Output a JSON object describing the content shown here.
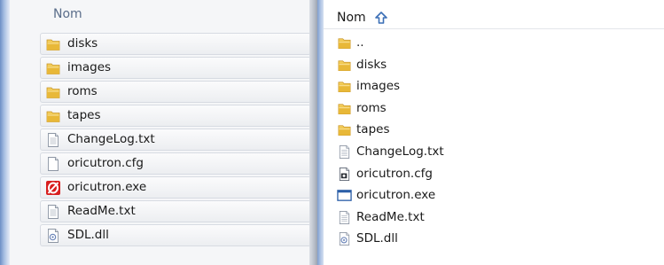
{
  "left_pane": {
    "column_header": "Nom",
    "files": [
      {
        "name": "disks",
        "icon": "folder-icon"
      },
      {
        "name": "images",
        "icon": "folder-icon"
      },
      {
        "name": "roms",
        "icon": "folder-icon"
      },
      {
        "name": "tapes",
        "icon": "folder-icon"
      },
      {
        "name": "ChangeLog.txt",
        "icon": "text-file-icon"
      },
      {
        "name": "oricutron.cfg",
        "icon": "blank-file-icon"
      },
      {
        "name": "oricutron.exe",
        "icon": "oricutron-app-icon"
      },
      {
        "name": "ReadMe.txt",
        "icon": "text-file-icon"
      },
      {
        "name": "SDL.dll",
        "icon": "dll-file-icon"
      }
    ]
  },
  "right_pane": {
    "column_header": "Nom",
    "sort_indicator": "sort-ascending-icon",
    "files": [
      {
        "name": "..",
        "icon": "folder-icon"
      },
      {
        "name": "disks",
        "icon": "folder-icon"
      },
      {
        "name": "images",
        "icon": "folder-icon"
      },
      {
        "name": "roms",
        "icon": "folder-icon"
      },
      {
        "name": "tapes",
        "icon": "folder-icon"
      },
      {
        "name": "ChangeLog.txt",
        "icon": "text-file-icon"
      },
      {
        "name": "oricutron.cfg",
        "icon": "config-file-icon"
      },
      {
        "name": "oricutron.exe",
        "icon": "window-app-icon"
      },
      {
        "name": "ReadMe.txt",
        "icon": "text-file-icon"
      },
      {
        "name": "SDL.dll",
        "icon": "dll-file-icon"
      }
    ]
  },
  "colors": {
    "folder": "#e8b838",
    "header_left": "#5a6d8a",
    "sort_arrow": "#3b6fb6",
    "exe_red": "#d81e1e"
  }
}
